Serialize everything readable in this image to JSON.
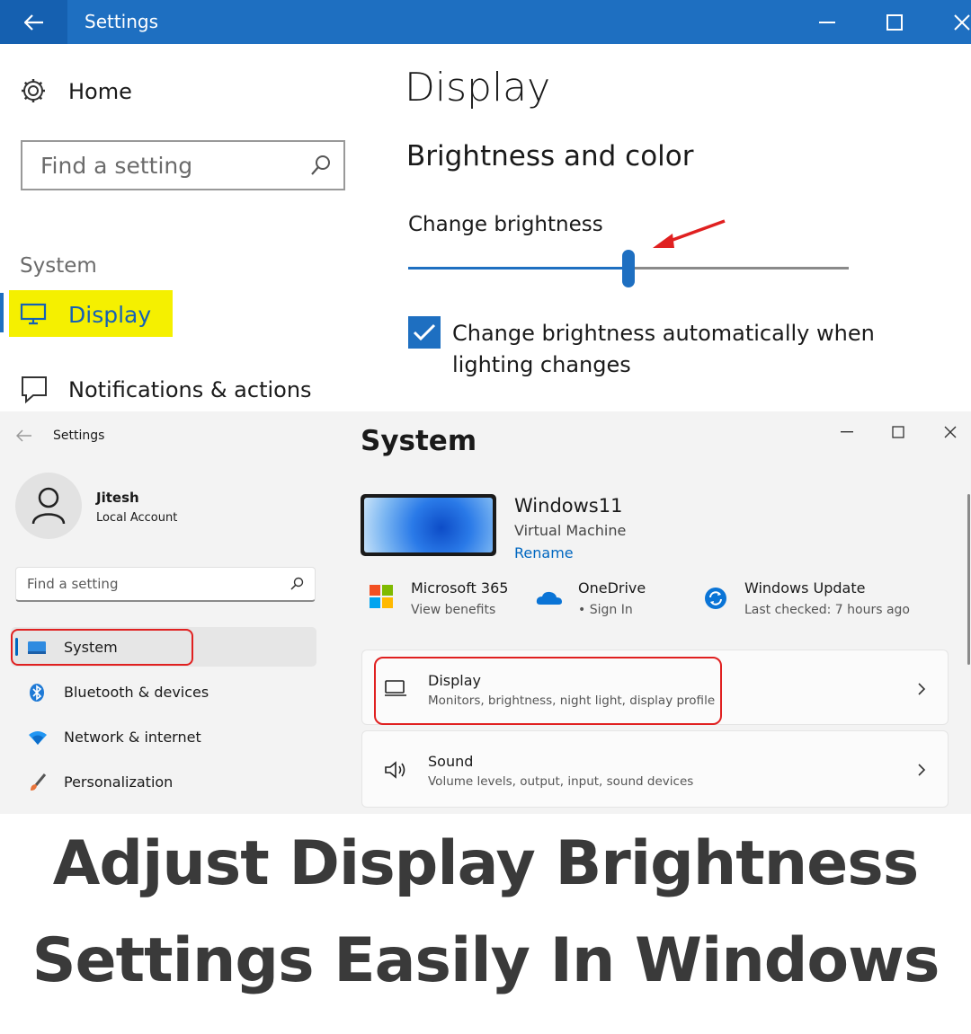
{
  "win10": {
    "title": "Settings",
    "nav": {
      "home_label": "Home",
      "search_placeholder": "Find a setting",
      "category": "System",
      "display_label": "Display",
      "notifications_label": "Notifications & actions"
    },
    "main": {
      "page_title": "Display",
      "section_title": "Brightness and color",
      "brightness_label": "Change brightness",
      "brightness_level": 0.5,
      "auto_brightness_label": "Change brightness automatically when lighting changes",
      "auto_brightness_checked": true
    },
    "colors": {
      "titlebar": "#1e6fc1",
      "accent": "#1e6fc1",
      "highlight": "#f5f000",
      "annotation_arrow": "#e02020"
    }
  },
  "win11": {
    "title": "Settings",
    "user": {
      "name": "Jitesh",
      "account_type": "Local Account"
    },
    "search_placeholder": "Find a setting",
    "nav_items": [
      {
        "label": "System",
        "icon": "system-icon",
        "selected": true
      },
      {
        "label": "Bluetooth & devices",
        "icon": "bluetooth-icon"
      },
      {
        "label": "Network & internet",
        "icon": "wifi-icon"
      },
      {
        "label": "Personalization",
        "icon": "brush-icon"
      }
    ],
    "page_title": "System",
    "device": {
      "name": "Windows11",
      "type": "Virtual Machine",
      "rename_label": "Rename"
    },
    "tiles": [
      {
        "title": "Microsoft 365",
        "subtitle": "View benefits",
        "icon": "microsoft-logo-icon"
      },
      {
        "title": "OneDrive",
        "subtitle": "• Sign In",
        "icon": "onedrive-icon"
      },
      {
        "title": "Windows Update",
        "subtitle": "Last checked: 7 hours ago",
        "icon": "windows-update-icon"
      }
    ],
    "cards": [
      {
        "title": "Display",
        "subtitle": "Monitors, brightness, night light, display profile",
        "icon": "monitor-icon"
      },
      {
        "title": "Sound",
        "subtitle": "Volume levels, output, input, sound devices",
        "icon": "speaker-icon"
      }
    ],
    "colors": {
      "accent": "#0067c0",
      "annotation_box": "#e02020"
    }
  },
  "caption": {
    "line1": "Adjust Display Brightness",
    "line2": "Settings Easily In Windows"
  }
}
